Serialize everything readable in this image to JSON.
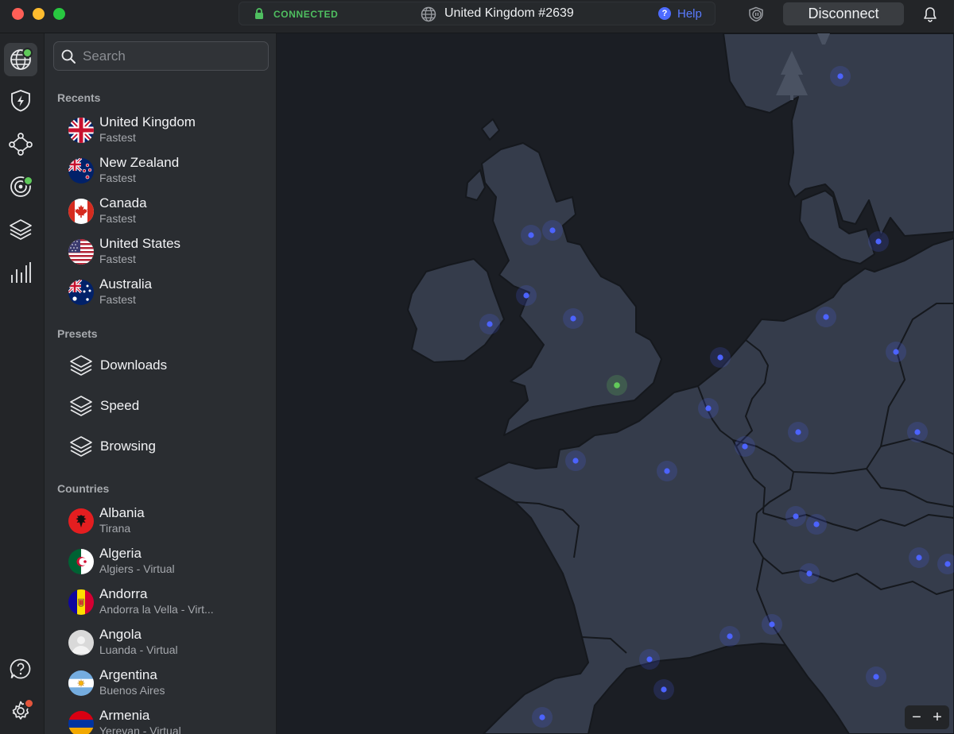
{
  "titlebar": {
    "status": "CONNECTED",
    "server": "United Kingdom #2639",
    "help": "Help",
    "disconnect": "Disconnect"
  },
  "rail": {
    "icons": [
      "globe-icon",
      "shield-bolt-icon",
      "meshnet-icon",
      "target-icon",
      "layers-icon",
      "stats-icon",
      "help-circle-icon",
      "settings-icon"
    ]
  },
  "search": {
    "placeholder": "Search",
    "value": ""
  },
  "recents": {
    "heading": "Recents",
    "items": [
      {
        "name": "United Kingdom",
        "sub": "Fastest"
      },
      {
        "name": "New Zealand",
        "sub": "Fastest"
      },
      {
        "name": "Canada",
        "sub": "Fastest"
      },
      {
        "name": "United States",
        "sub": "Fastest"
      },
      {
        "name": "Australia",
        "sub": "Fastest"
      }
    ]
  },
  "presets": {
    "heading": "Presets",
    "items": [
      {
        "name": "Downloads"
      },
      {
        "name": "Speed"
      },
      {
        "name": "Browsing"
      }
    ]
  },
  "countries": {
    "heading": "Countries",
    "items": [
      {
        "name": "Albania",
        "sub": "Tirana"
      },
      {
        "name": "Algeria",
        "sub": "Algiers - Virtual"
      },
      {
        "name": "Andorra",
        "sub": "Andorra la Vella - Virt..."
      },
      {
        "name": "Angola",
        "sub": "Luanda - Virtual"
      },
      {
        "name": "Argentina",
        "sub": "Buenos Aires"
      },
      {
        "name": "Armenia",
        "sub": "Yerevan - Virtual"
      }
    ]
  },
  "map": {
    "zoom_out": "−",
    "zoom_in": "+",
    "colors": {
      "sea": "#1b1e24",
      "land": "#353c4b",
      "border": "#15181d",
      "server": "#4c63ff",
      "connected": "#62c95a"
    }
  }
}
